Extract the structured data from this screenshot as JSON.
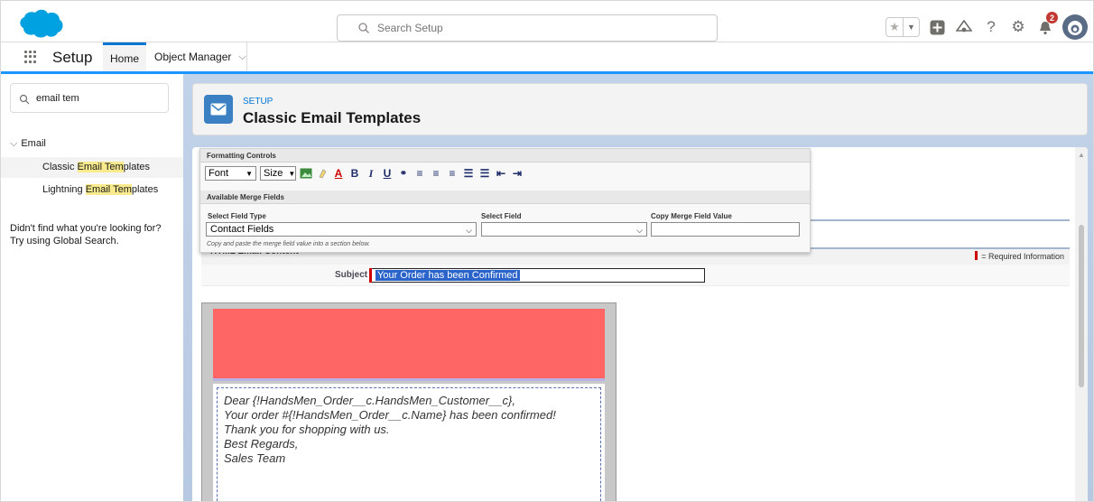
{
  "header": {
    "search_placeholder": "Search Setup",
    "notification_count": "2",
    "icons": [
      "star-icon",
      "chevron-down-icon",
      "add-icon",
      "trailhead-icon",
      "help-icon",
      "gear-icon",
      "bell-icon",
      "avatar"
    ]
  },
  "nav": {
    "app_name": "Setup",
    "tabs": [
      {
        "label": "Home",
        "active": true
      },
      {
        "label": "Object Manager",
        "active": false
      }
    ]
  },
  "sidebar": {
    "quick_find_value": "email tem",
    "group_label": "Email",
    "items": [
      {
        "before": "Classic ",
        "match": "Email Tem",
        "after": "plates",
        "selected": true
      },
      {
        "before": "Lightning ",
        "match": "Email Tem",
        "after": "plates",
        "selected": false
      }
    ],
    "not_found_line1": "Didn't find what you're looking for?",
    "not_found_line2": "Try using Global Search."
  },
  "page_header": {
    "crumb": "SETUP",
    "title": "Classic Email Templates"
  },
  "formatting": {
    "title": "Formatting Controls",
    "font_label": "Font",
    "size_label": "Size"
  },
  "merge": {
    "title": "Available Merge Fields",
    "field_type_label": "Select Field Type",
    "field_type_value": "Contact Fields",
    "field_label": "Select Field",
    "field_value": "",
    "copy_label": "Copy Merge Field Value",
    "copy_value": "",
    "help": "Copy and paste the merge field value into a section below."
  },
  "section": {
    "title": "HTML Email Content",
    "required_note": "= Required Information"
  },
  "subject": {
    "label": "Subject",
    "value": "Your Order has been Confirmed"
  },
  "email": {
    "lines": [
      "Dear {!HandsMen_Order__c.HandsMen_Customer__c},",
      "Your order #{!HandsMen_Order__c.Name} has been confirmed!",
      "Thank you for shopping with us.",
      "Best Regards,",
      "Sales Team"
    ]
  },
  "colors": {
    "brand": "#0176d3",
    "banner": "#fe6666",
    "header_icon": "#3b80c3"
  }
}
